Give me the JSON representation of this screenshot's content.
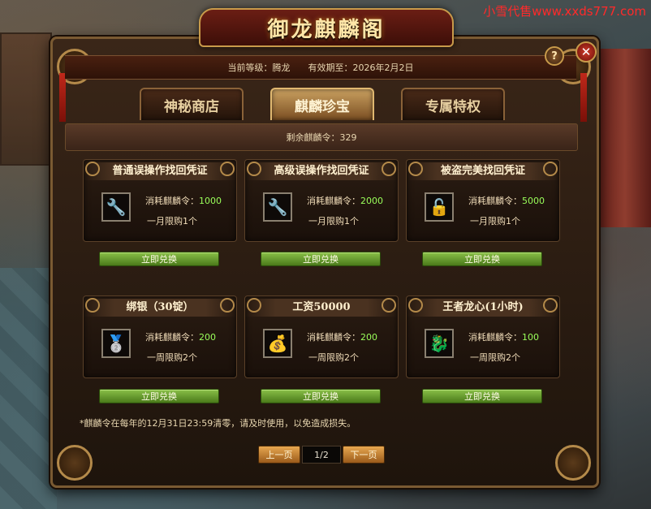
{
  "watermark": "小雪代售www.xxds777.com",
  "title": "御龙麒麟阁",
  "info": {
    "level_label": "当前等级：腾龙",
    "expiry_label": "有效期至：2026年2月2日"
  },
  "buttons": {
    "help": "?",
    "close": "✕"
  },
  "tabs": [
    {
      "label": "神秘商店",
      "active": false
    },
    {
      "label": "麒麟珍宝",
      "active": true
    },
    {
      "label": "专属特权",
      "active": false
    }
  ],
  "remaining": "剩余麒麟令：329",
  "cost_label": "消耗麒麟令：",
  "redeem_label": "立即兑换",
  "items": [
    {
      "name": "普通误操作找回凭证",
      "icon": "wrench-icon",
      "glyph": "🔧",
      "cost": "1000",
      "limit": "一月限购1个"
    },
    {
      "name": "高级误操作找回凭证",
      "icon": "wrench-icon",
      "glyph": "🔧",
      "cost": "2000",
      "limit": "一月限购1个"
    },
    {
      "name": "被盗完美找回凭证",
      "icon": "padlock-icon",
      "glyph": "🔓",
      "cost": "5000",
      "limit": "一月限购1个"
    },
    {
      "name": "绑银（30锭）",
      "icon": "silver-ingot-icon",
      "glyph": "🥈",
      "cost": "200",
      "limit": "一周限购2个"
    },
    {
      "name": "工资50000",
      "icon": "gold-coins-icon",
      "glyph": "💰",
      "cost": "200",
      "limit": "一周限购2个"
    },
    {
      "name": "王者龙心(1小时)",
      "icon": "dragon-heart-icon",
      "glyph": "🐉",
      "cost": "100",
      "limit": "一周限购2个"
    }
  ],
  "note": "*麒麟令在每年的12月31日23:59清零，请及时使用，以免造成损失。",
  "pager": {
    "prev": "上一页",
    "page": "1/2",
    "next": "下一页"
  },
  "colors": {
    "accent_gold": "#c89a4a",
    "cost_green": "#9aff5a",
    "redeem_green": "#6aa030",
    "close_red": "#d03a2a"
  }
}
